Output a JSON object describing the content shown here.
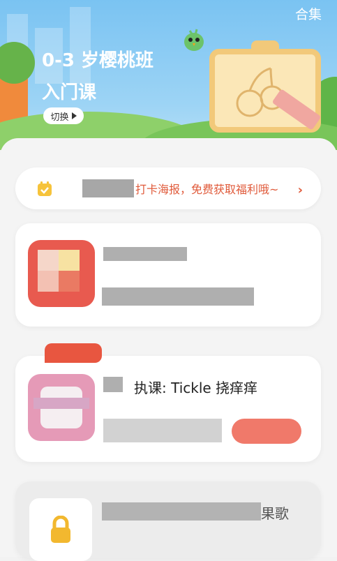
{
  "header": {
    "collection_label": "合集",
    "title_line1": "0-3 岁樱桃班",
    "title_line2": "入门课",
    "switch_label": "切换"
  },
  "banner": {
    "text": "打卡海报，免费获取福利哦~",
    "chevron": "›"
  },
  "courses": [
    {
      "title_suffix": ""
    },
    {
      "ribbon_label": "",
      "title": "执课: Tickle 挠痒痒"
    },
    {
      "title_suffix": "果歌"
    }
  ],
  "colors": {
    "accent": "#e05a3a",
    "sky": "#7ac3f2",
    "card": "#ffffff",
    "background": "#f4f4f4"
  },
  "icons": {
    "banner": "calendar-check-icon",
    "locked": "lock-icon",
    "switch": "triangle-right-icon"
  }
}
